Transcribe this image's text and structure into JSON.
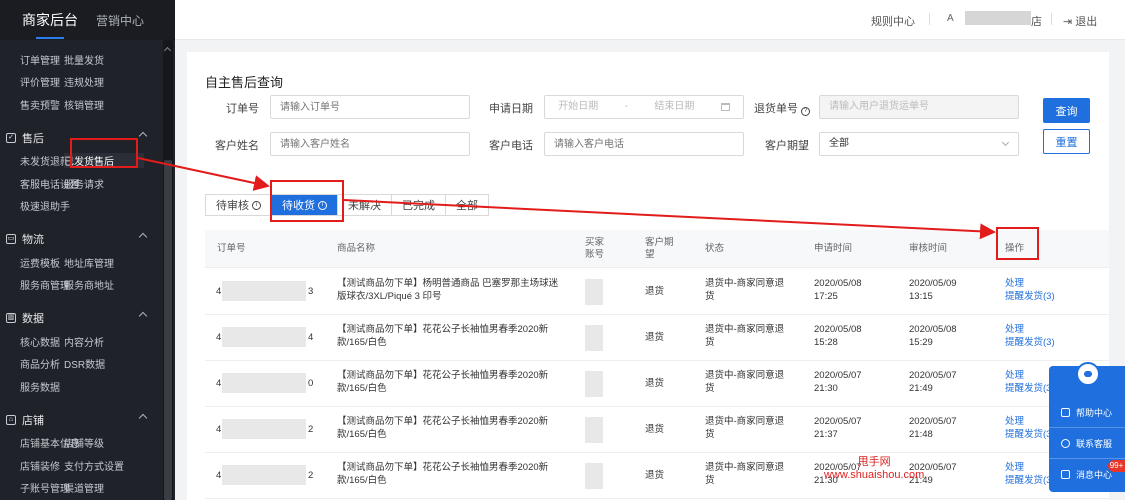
{
  "sidebar": {
    "header": {
      "title": "商家后台",
      "tab": "营销中心"
    },
    "top_rows": [
      [
        "订单管理",
        "批量发货"
      ],
      [
        "评价管理",
        "违规处理"
      ],
      [
        "售卖预警",
        "核销管理"
      ]
    ],
    "groups": [
      {
        "title": "售后",
        "rows": [
          [
            "未发货退款",
            "已发货售后"
          ],
          [
            "客服电话设置",
            "服务请求"
          ],
          [
            "极速退助手",
            ""
          ]
        ]
      },
      {
        "title": "物流",
        "rows": [
          [
            "运费模板",
            "地址库管理"
          ],
          [
            "服务商管理",
            "服务商地址"
          ]
        ]
      },
      {
        "title": "数据",
        "rows": [
          [
            "核心数据",
            "内容分析"
          ],
          [
            "商品分析",
            "DSR数据"
          ],
          [
            "服务数据",
            ""
          ]
        ]
      },
      {
        "title": "店铺",
        "rows": [
          [
            "店铺基本信息",
            "店铺等级"
          ],
          [
            "店铺装修",
            "支付方式设置"
          ],
          [
            "子账号管理",
            "渠道管理"
          ]
        ]
      }
    ]
  },
  "topbar": {
    "rules": "规则中心",
    "user_icon": "A",
    "store_suffix": "店",
    "logout": "退出"
  },
  "search": {
    "title": "自主售后查询",
    "order_no_label": "订单号",
    "order_no_placeholder": "请输入订单号",
    "apply_date_label": "申请日期",
    "start_date_placeholder": "开始日期",
    "date_sep": "-",
    "end_date_placeholder": "结束日期",
    "return_no_label": "退货单号",
    "return_no_placeholder": "请输入用户退货运单号",
    "customer_name_label": "客户姓名",
    "customer_name_placeholder": "请输入客户姓名",
    "customer_phone_label": "客户电话",
    "customer_phone_placeholder": "请输入客户电话",
    "expect_label": "客户期望",
    "expect_value": "全部",
    "query_button": "查询",
    "reset_button": "重置"
  },
  "tabs": [
    {
      "label": "待审核",
      "info": true,
      "active": false
    },
    {
      "label": "待收货",
      "info": true,
      "active": true
    },
    {
      "label": "未解决",
      "info": false,
      "active": false
    },
    {
      "label": "已完成",
      "info": false,
      "active": false
    },
    {
      "label": "全部",
      "info": false,
      "active": false
    }
  ],
  "table": {
    "columns": [
      "订单号",
      "商品名称",
      "买家账号",
      "客户期望",
      "状态",
      "申请时间",
      "审核时间",
      "操作"
    ],
    "rows": [
      {
        "order_start": "4",
        "order_end": "3",
        "product": "【测试商品勿下单】杨明普通商品 巴塞罗那主场球迷版球衣/3XL/Piqué 3 印号",
        "expect": "退货",
        "status": "退货中-商家同意退货",
        "apply_date": "2020/05/08",
        "apply_time": "17:25",
        "review_date": "2020/05/09",
        "review_time": "13:15",
        "action1": "处理",
        "action2": "提醒发货(3)"
      },
      {
        "order_start": "4",
        "order_end": "4",
        "product": "【测试商品勿下单】花花公子长袖恤男春季2020新款/165/白色",
        "expect": "退货",
        "status": "退货中-商家同意退货",
        "apply_date": "2020/05/08",
        "apply_time": "15:28",
        "review_date": "2020/05/08",
        "review_time": "15:29",
        "action1": "处理",
        "action2": "提醒发货(3)"
      },
      {
        "order_start": "4",
        "order_end": "0",
        "product": "【测试商品勿下单】花花公子长袖恤男春季2020新款/165/白色",
        "expect": "退货",
        "status": "退货中-商家同意退货",
        "apply_date": "2020/05/07",
        "apply_time": "21:30",
        "review_date": "2020/05/07",
        "review_time": "21:49",
        "action1": "处理",
        "action2": "提醒发货(3)"
      },
      {
        "order_start": "4",
        "order_end": "2",
        "product": "【测试商品勿下单】花花公子长袖恤男春季2020新款/165/白色",
        "expect": "退货",
        "status": "退货中-商家同意退货",
        "apply_date": "2020/05/07",
        "apply_time": "21:37",
        "review_date": "2020/05/07",
        "review_time": "21:48",
        "action1": "处理",
        "action2": "提醒发货(3)"
      },
      {
        "order_start": "4",
        "order_end": "2",
        "product": "【测试商品勿下单】花花公子长袖恤男春季2020新款/165/白色",
        "expect": "退货",
        "status": "退货中-商家同意退货",
        "apply_date": "2020/05/07",
        "apply_time": "21:30",
        "review_date": "2020/05/07",
        "review_time": "21:49",
        "action1": "处理",
        "action2": "提醒发货(3)"
      }
    ]
  },
  "help_panel": {
    "items": [
      "帮助中心",
      "联系客服",
      "消息中心"
    ],
    "badge": "99+"
  },
  "watermark": {
    "line1": "甩手网",
    "line2": "www.shuaishou.com"
  },
  "colors": {
    "primary": "#1f6fde",
    "sidebar_bg": "#1f2229",
    "highlight": "#e21b1b"
  }
}
